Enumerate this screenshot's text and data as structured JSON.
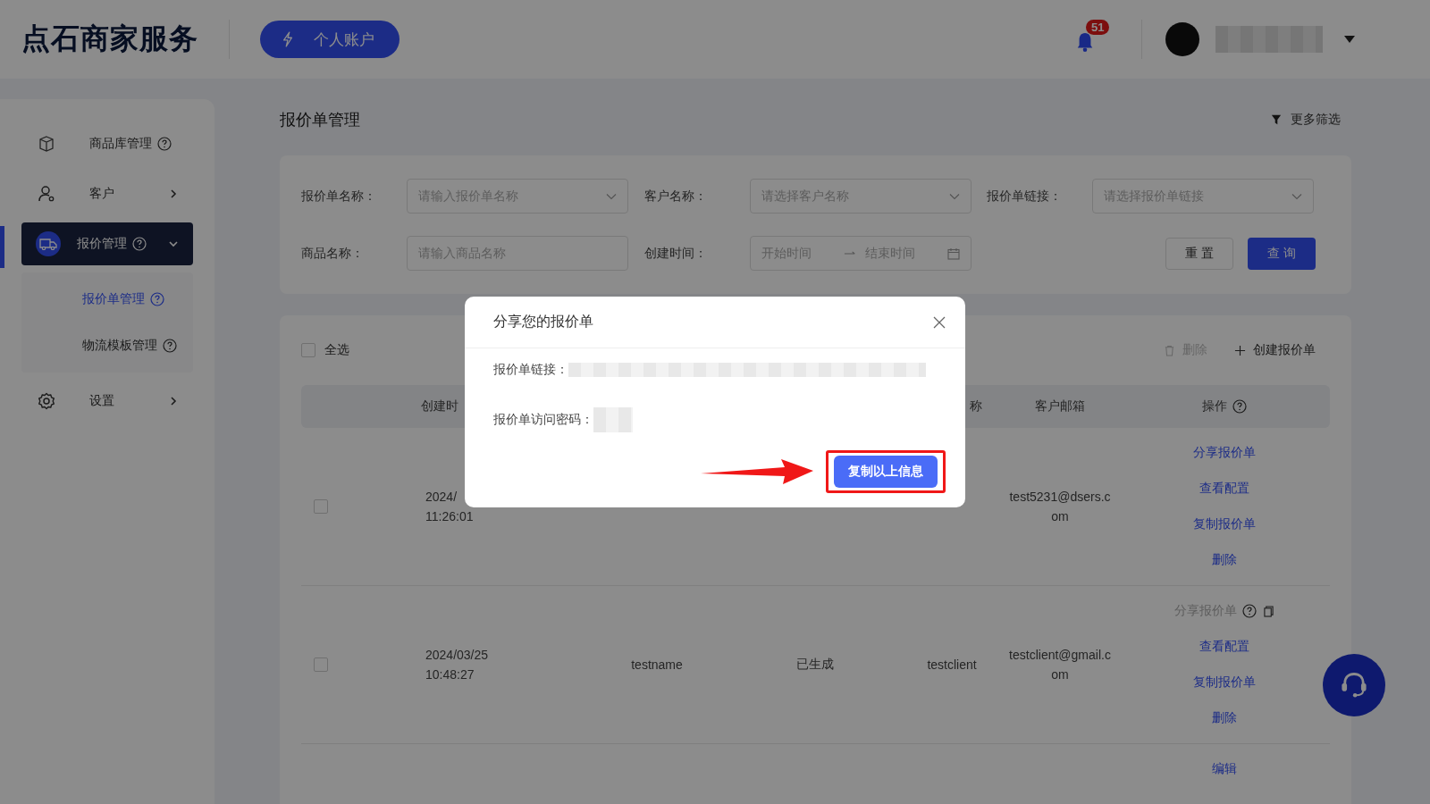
{
  "header": {
    "logo": "点石商家服务",
    "account_button": "个人账户",
    "notification_count": "51"
  },
  "sidebar": {
    "items": [
      {
        "label": "商品库管理",
        "kind": "link",
        "help": true,
        "selected": false
      },
      {
        "label": "客户",
        "kind": "group",
        "expanded": false,
        "selected": false
      },
      {
        "label": "报价管理",
        "kind": "group",
        "help": true,
        "expanded": true,
        "selected": true,
        "children": [
          {
            "label": "报价单管理",
            "help": true,
            "selected": true
          },
          {
            "label": "物流模板管理",
            "help": true,
            "selected": false
          }
        ]
      },
      {
        "label": "设置",
        "kind": "group",
        "expanded": false,
        "selected": false
      }
    ]
  },
  "page": {
    "title": "报价单管理",
    "more_filters": "更多筛选"
  },
  "filters": [
    {
      "label": "报价单名称：",
      "kind": "select",
      "placeholder": "请输入报价单名称"
    },
    {
      "label": "客户名称：",
      "kind": "select",
      "placeholder": "请选择客户名称"
    },
    {
      "label": "报价单链接：",
      "kind": "select",
      "placeholder": "请选择报价单链接"
    },
    {
      "label": "商品名称：",
      "kind": "input",
      "placeholder": "请输入商品名称"
    },
    {
      "label": "创建时间：",
      "kind": "range",
      "start_placeholder": "开始时间",
      "end_placeholder": "结束时间"
    }
  ],
  "filter_buttons": {
    "reset": "重 置",
    "query": "查 询"
  },
  "toolbar": {
    "select_all": "全选",
    "select_all_checked": false,
    "delete": "删除",
    "delete_disabled": true,
    "create": "创建报价单"
  },
  "table": {
    "header": {
      "created": "创建时",
      "client": "称",
      "email": "客户邮箱",
      "actions": "操作",
      "actions_help": true
    },
    "rows": [
      {
        "checked": false,
        "created": [
          "2024/",
          "11:26:01"
        ],
        "email": "test5231@dsers.com",
        "actions": [
          {
            "label": "分享报价单",
            "disabled": false
          },
          {
            "label": "查看配置",
            "disabled": false
          },
          {
            "label": "复制报价单",
            "disabled": false
          },
          {
            "label": "删除",
            "disabled": false
          }
        ]
      },
      {
        "checked": false,
        "created": [
          "2024/03/25",
          "10:48:27"
        ],
        "name": "testname",
        "status": "已生成",
        "client": "testclient",
        "email": "testclient@gmail.com",
        "actions": [
          {
            "label": "分享报价单",
            "disabled": true
          },
          {
            "label": "查看配置",
            "disabled": false
          },
          {
            "label": "复制报价单",
            "disabled": false
          },
          {
            "label": "删除",
            "disabled": false
          }
        ]
      },
      {
        "actions": [
          {
            "label": "编辑",
            "disabled": false
          }
        ]
      }
    ]
  },
  "modal": {
    "title": "分享您的报价单",
    "fields": [
      {
        "label": "报价单链接："
      },
      {
        "label": "报价单访问密码："
      }
    ],
    "copy_button": "复制以上信息"
  }
}
